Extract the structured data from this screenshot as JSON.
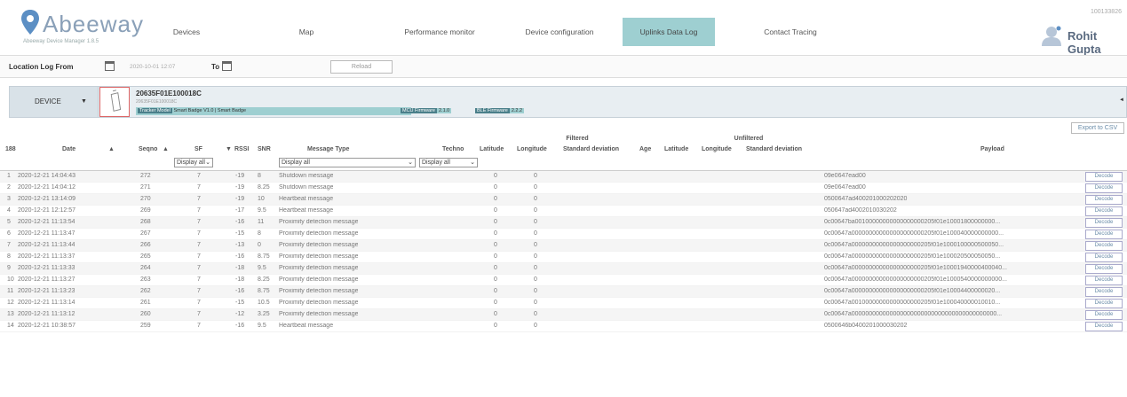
{
  "brand": {
    "name": "Abeeway",
    "sub": "Abeeway Device Manager 1.8.5"
  },
  "nav": [
    {
      "label": "Devices",
      "active": false
    },
    {
      "label": "Map",
      "active": false
    },
    {
      "label": "Performance monitor",
      "active": false
    },
    {
      "label": "Device configuration",
      "active": false
    },
    {
      "label": "Uplinks Data Log",
      "active": true
    },
    {
      "label": "Contact Tracing",
      "active": false
    }
  ],
  "version": "100133826",
  "user": {
    "name": "Rohit Gupta",
    "icon": "user-avatar-icon"
  },
  "location_bar": {
    "from_label": "Location Log From",
    "from_value": "2020-10-01 12:07",
    "to_label": "To",
    "to_value": "",
    "reload_label": "Reload"
  },
  "device": {
    "select_label": "DEVICE",
    "id": "20635F01E100018C",
    "sub": "20635F01E100018C",
    "model_label": "Tracker Model",
    "model_value": "Smart Badge V1.0 | Smart Badge",
    "mcu_label": "MCU Firmware",
    "mcu_value": "2.1.0",
    "ble_label": "BLE Firmware",
    "ble_value": "2.2.2"
  },
  "export_label": "Export to CSV",
  "groups": {
    "filtered": "Filtered",
    "unfiltered": "Unfiltered"
  },
  "columns": {
    "count": "188",
    "date": "Date",
    "seqno": "Seqno",
    "sf": "SF",
    "rssi": "RSSI",
    "snr": "SNR",
    "msgtype": "Message Type",
    "techno": "Techno",
    "lat": "Latitude",
    "lon": "Longitude",
    "std": "Standard deviation",
    "age": "Age",
    "ulat": "Latitude",
    "ulon": "Longitude",
    "ustd": "Standard deviation",
    "payload": "Payload"
  },
  "filters": {
    "sf": "Display all",
    "msgtype": "Display all",
    "techno": "Display all"
  },
  "decode_label": "Decode",
  "rows": [
    {
      "n": "1",
      "date": "2020-12-21 14:04:43",
      "seq": "272",
      "sf": "7",
      "rssi": "-19",
      "snr": "8",
      "type": "Shutdown message",
      "lat": "0",
      "lon": "0",
      "payload": "09e0647ead00"
    },
    {
      "n": "2",
      "date": "2020-12-21 14:04:12",
      "seq": "271",
      "sf": "7",
      "rssi": "-19",
      "snr": "8.25",
      "type": "Shutdown message",
      "lat": "0",
      "lon": "0",
      "payload": "09e0647ead00"
    },
    {
      "n": "3",
      "date": "2020-12-21 13:14:09",
      "seq": "270",
      "sf": "7",
      "rssi": "-19",
      "snr": "10",
      "type": "Heartbeat message",
      "lat": "0",
      "lon": "0",
      "payload": "0500647ad400201000202020"
    },
    {
      "n": "4",
      "date": "2020-12-21 12:12:57",
      "seq": "269",
      "sf": "7",
      "rssi": "-17",
      "snr": "9.5",
      "type": "Heartbeat message",
      "lat": "0",
      "lon": "0",
      "payload": "050647ad4002010030202"
    },
    {
      "n": "5",
      "date": "2020-12-21 11:13:54",
      "seq": "268",
      "sf": "7",
      "rssi": "-16",
      "snr": "11",
      "type": "Proximity detection message",
      "lat": "0",
      "lon": "0",
      "payload": "0c00647ba00100000000000000000205f01e10001800000000..."
    },
    {
      "n": "6",
      "date": "2020-12-21 11:13:47",
      "seq": "267",
      "sf": "7",
      "rssi": "-15",
      "snr": "8",
      "type": "Proximity detection message",
      "lat": "0",
      "lon": "0",
      "payload": "0c00647a000000000000000000000205f01e100040000000000..."
    },
    {
      "n": "7",
      "date": "2020-12-21 11:13:44",
      "seq": "266",
      "sf": "7",
      "rssi": "-13",
      "snr": "0",
      "type": "Proximity detection message",
      "lat": "0",
      "lon": "0",
      "payload": "0c00647a00000000000000000000205f01e1000100000500050..."
    },
    {
      "n": "8",
      "date": "2020-12-21 11:13:37",
      "seq": "265",
      "sf": "7",
      "rssi": "-16",
      "snr": "8.75",
      "type": "Proximity detection message",
      "lat": "0",
      "lon": "0",
      "payload": "0c00647a00000000000000000000205f01e100020500050050..."
    },
    {
      "n": "9",
      "date": "2020-12-21 11:13:33",
      "seq": "264",
      "sf": "7",
      "rssi": "-18",
      "snr": "9.5",
      "type": "Proximity detection message",
      "lat": "0",
      "lon": "0",
      "payload": "0c00647a00000000000000000000205f01e10001940000400040..."
    },
    {
      "n": "10",
      "date": "2020-12-21 11:13:27",
      "seq": "263",
      "sf": "7",
      "rssi": "-18",
      "snr": "8.25",
      "type": "Proximity detection message",
      "lat": "0",
      "lon": "0",
      "payload": "0c00647a000000000000000000000205f01e1000540000000000..."
    },
    {
      "n": "11",
      "date": "2020-12-21 11:13:23",
      "seq": "262",
      "sf": "7",
      "rssi": "-16",
      "snr": "8.75",
      "type": "Proximity detection message",
      "lat": "0",
      "lon": "0",
      "payload": "0c00647a000000000000000000000205f01e10004400000020..."
    },
    {
      "n": "12",
      "date": "2020-12-21 11:13:14",
      "seq": "261",
      "sf": "7",
      "rssi": "-15",
      "snr": "10.5",
      "type": "Proximity detection message",
      "lat": "0",
      "lon": "0",
      "payload": "0c00647a00100000000000000000205f01e100040000010010..."
    },
    {
      "n": "13",
      "date": "2020-12-21 11:13:12",
      "seq": "260",
      "sf": "7",
      "rssi": "-12",
      "snr": "3.25",
      "type": "Proximity detection message",
      "lat": "0",
      "lon": "0",
      "payload": "0c00647a000000000000000000000000000000000000000000..."
    },
    {
      "n": "14",
      "date": "2020-12-21 10:38:57",
      "seq": "259",
      "sf": "7",
      "rssi": "-16",
      "snr": "9.5",
      "type": "Heartbeat message",
      "lat": "0",
      "lon": "0",
      "payload": "0500646b0400201000030202"
    }
  ]
}
